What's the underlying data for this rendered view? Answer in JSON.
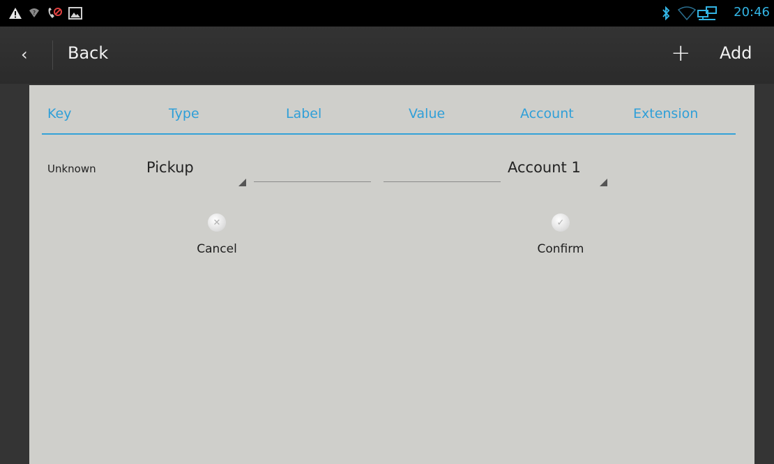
{
  "status_bar": {
    "icons_left": [
      "warning-icon",
      "wifi-question-icon",
      "call-blocked-icon",
      "image-icon"
    ],
    "icons_right": [
      "bluetooth-icon",
      "wifi-empty-icon",
      "network-icon"
    ],
    "time": "20:46",
    "accent_color": "#33b5e5"
  },
  "action_bar": {
    "back_chevron": "‹",
    "back_label": "Back",
    "add_plus": "+",
    "add_label": "Add"
  },
  "table": {
    "columns": [
      "Key",
      "Type",
      "Label",
      "Value",
      "Account",
      "Extension"
    ],
    "header_color": "#2f9fd8",
    "row": {
      "key": "Unknown",
      "type": "Pickup",
      "label": "",
      "value": "",
      "account": "Account 1",
      "extension": ""
    }
  },
  "actions": {
    "cancel_icon": "✕",
    "cancel_label": "Cancel",
    "confirm_icon": "✓",
    "confirm_label": "Confirm"
  }
}
